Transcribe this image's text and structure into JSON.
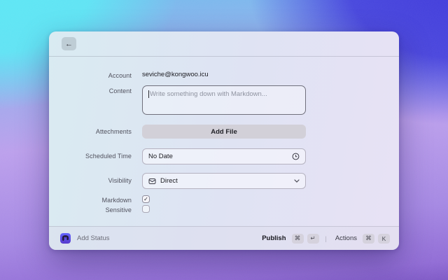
{
  "colors": {
    "brand_purple": "#6364ff",
    "brand_purple_dark": "#563acc",
    "bg_cyan": "#58e6f4",
    "bg_blue": "#3b35da",
    "bg_purple": "#8d67d4"
  },
  "header": {
    "back_icon": "←"
  },
  "form": {
    "account": {
      "label": "Account",
      "value": "seviche@kongwoo.icu"
    },
    "content": {
      "label": "Content",
      "placeholder": "Write something down with Markdown..."
    },
    "attachments": {
      "label": "Attechments",
      "button_label": "Add File"
    },
    "scheduled_time": {
      "label": "Scheduled Time",
      "value": "No Date"
    },
    "visibility": {
      "label": "Visibility",
      "value": "Direct"
    },
    "markdown": {
      "label": "Markdown",
      "checked": true,
      "check_glyph": "✓"
    },
    "sensitive": {
      "label": "Sensitive",
      "checked": false,
      "check_glyph": "✓"
    }
  },
  "footer": {
    "title": "Add Status",
    "publish_label": "Publish",
    "publish_keys": [
      "⌘",
      "↵"
    ],
    "separator": "|",
    "actions_label": "Actions",
    "actions_keys": [
      "⌘",
      "K"
    ]
  }
}
